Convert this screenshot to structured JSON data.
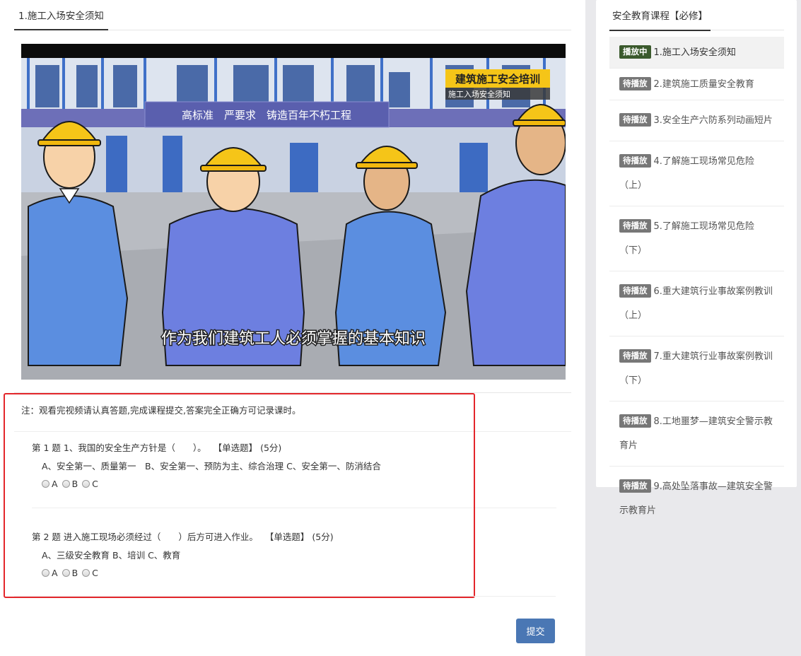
{
  "main": {
    "tab_label": "1.施工入场安全须知",
    "video": {
      "title_badge": "建筑施工安全培训",
      "subtitle_badge": "施工入场安全须知",
      "banner": "高标准　严要求　铸造百年不朽工程",
      "caption": "作为我们建筑工人必须掌握的基本知识"
    },
    "note": "注：观看完视频请认真答题,完成课程提交,答案完全正确方可记录课时。",
    "questions": [
      {
        "title": "第 1 题 1、我国的安全生产方针是（　　）。",
        "type": "【单选题】",
        "score": "(5分)",
        "options_text": "A、安全第一、质量第一　B、安全第一、预防为主、综合治理 C、安全第一、防消结合",
        "answers": [
          "A",
          "B",
          "C"
        ]
      },
      {
        "title": "第 2 题 进入施工现场必须经过（　　）后方可进入作业。",
        "type": "【单选题】",
        "score": "(5分)",
        "options_text": "A、三级安全教育 B、培训 C、教育",
        "answers": [
          "A",
          "B",
          "C"
        ]
      }
    ],
    "submit_label": "提交"
  },
  "sidebar": {
    "title": "安全教育课程【必修】",
    "items": [
      {
        "status": "播放中",
        "label": "1.施工入场安全须知"
      },
      {
        "status": "待播放",
        "label": "2.建筑施工质量安全教育"
      },
      {
        "status": "待播放",
        "label": "3.安全生产六防系列动画短片"
      },
      {
        "status": "待播放",
        "label": "4.了解施工现场常见危险（上）"
      },
      {
        "status": "待播放",
        "label": "5.了解施工现场常见危险（下）"
      },
      {
        "status": "待播放",
        "label": "6.重大建筑行业事故案例教训（上）"
      },
      {
        "status": "待播放",
        "label": "7.重大建筑行业事故案例教训（下）"
      },
      {
        "status": "待播放",
        "label": "8.工地噩梦—建筑安全警示教育片"
      },
      {
        "status": "待播放",
        "label": "9.高处坠落事故—建筑安全警示教育片"
      }
    ]
  },
  "colors": {
    "accent": "#4a77b4",
    "badge_playing": "#3b5a2d",
    "badge_waiting": "#777777",
    "highlight": "#e3262b"
  }
}
